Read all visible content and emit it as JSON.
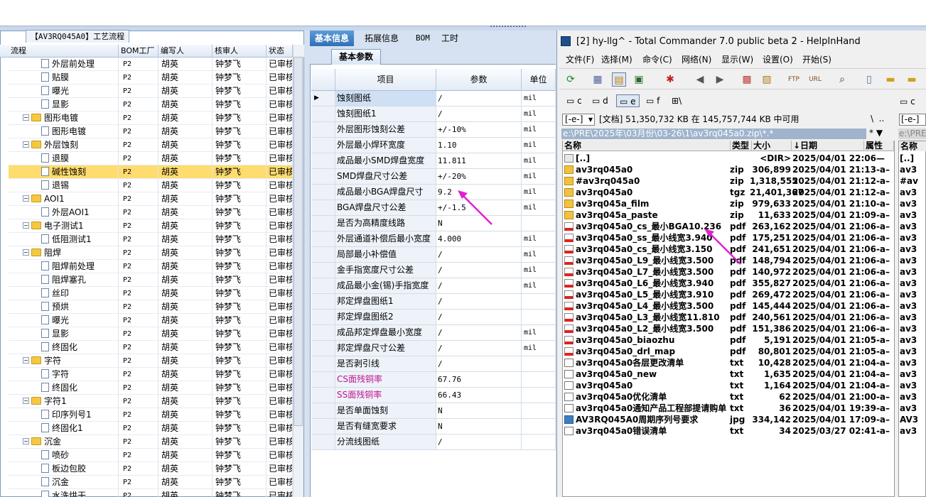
{
  "left_panel": {
    "title": "【AV3RQ045A0】工艺流程",
    "headers": [
      "流程",
      "BOM工厂",
      "编写人",
      "核审人",
      "状态"
    ],
    "rows": [
      {
        "indent": 3,
        "icon": "doc",
        "label": "外层前处理",
        "factory": "P2",
        "writer": "胡英",
        "reviewer": "钟梦飞",
        "status": "已审核"
      },
      {
        "indent": 3,
        "icon": "doc",
        "label": "贴膜",
        "factory": "P2",
        "writer": "胡英",
        "reviewer": "钟梦飞",
        "status": "已审核"
      },
      {
        "indent": 3,
        "icon": "doc",
        "label": "曝光",
        "factory": "P2",
        "writer": "胡英",
        "reviewer": "钟梦飞",
        "status": "已审核"
      },
      {
        "indent": 3,
        "icon": "doc",
        "label": "显影",
        "factory": "P2",
        "writer": "胡英",
        "reviewer": "钟梦飞",
        "status": "已审核"
      },
      {
        "indent": 1,
        "icon": "folder",
        "label": "图形电镀",
        "factory": "P2",
        "writer": "胡英",
        "reviewer": "钟梦飞",
        "status": "已审核"
      },
      {
        "indent": 3,
        "icon": "doc",
        "label": "图形电镀",
        "factory": "P2",
        "writer": "胡英",
        "reviewer": "钟梦飞",
        "status": "已审核"
      },
      {
        "indent": 1,
        "icon": "folder",
        "label": "外层蚀刻",
        "factory": "P2",
        "writer": "胡英",
        "reviewer": "钟梦飞",
        "status": "已审核"
      },
      {
        "indent": 3,
        "icon": "doc",
        "label": "退膜",
        "factory": "P2",
        "writer": "胡英",
        "reviewer": "钟梦飞",
        "status": "已审核"
      },
      {
        "indent": 3,
        "icon": "doc",
        "label": "碱性蚀刻",
        "factory": "P2",
        "writer": "胡英",
        "reviewer": "钟梦飞",
        "status": "已审核",
        "selected": true
      },
      {
        "indent": 3,
        "icon": "doc",
        "label": "退锡",
        "factory": "P2",
        "writer": "胡英",
        "reviewer": "钟梦飞",
        "status": "已审核"
      },
      {
        "indent": 1,
        "icon": "folder",
        "label": "AOI1",
        "factory": "P2",
        "writer": "胡英",
        "reviewer": "钟梦飞",
        "status": "已审核"
      },
      {
        "indent": 3,
        "icon": "doc",
        "label": "外层AOI1",
        "factory": "P2",
        "writer": "胡英",
        "reviewer": "钟梦飞",
        "status": "已审核"
      },
      {
        "indent": 1,
        "icon": "folder",
        "label": "电子测试1",
        "factory": "P2",
        "writer": "胡英",
        "reviewer": "钟梦飞",
        "status": "已审核"
      },
      {
        "indent": 3,
        "icon": "doc",
        "label": "低阻测试1",
        "factory": "P2",
        "writer": "胡英",
        "reviewer": "钟梦飞",
        "status": "已审核"
      },
      {
        "indent": 1,
        "icon": "folder",
        "label": "阻焊",
        "factory": "P2",
        "writer": "胡英",
        "reviewer": "钟梦飞",
        "status": "已审核"
      },
      {
        "indent": 3,
        "icon": "doc",
        "label": "阻焊前处理",
        "factory": "P2",
        "writer": "胡英",
        "reviewer": "钟梦飞",
        "status": "已审核"
      },
      {
        "indent": 3,
        "icon": "doc",
        "label": "阻焊塞孔",
        "factory": "P2",
        "writer": "胡英",
        "reviewer": "钟梦飞",
        "status": "已审核"
      },
      {
        "indent": 3,
        "icon": "doc",
        "label": "丝印",
        "factory": "P2",
        "writer": "胡英",
        "reviewer": "钟梦飞",
        "status": "已审核"
      },
      {
        "indent": 3,
        "icon": "doc",
        "label": "预烘",
        "factory": "P2",
        "writer": "胡英",
        "reviewer": "钟梦飞",
        "status": "已审核"
      },
      {
        "indent": 3,
        "icon": "doc",
        "label": "曝光",
        "factory": "P2",
        "writer": "胡英",
        "reviewer": "钟梦飞",
        "status": "已审核"
      },
      {
        "indent": 3,
        "icon": "doc",
        "label": "显影",
        "factory": "P2",
        "writer": "胡英",
        "reviewer": "钟梦飞",
        "status": "已审核"
      },
      {
        "indent": 3,
        "icon": "doc",
        "label": "终固化",
        "factory": "P2",
        "writer": "胡英",
        "reviewer": "钟梦飞",
        "status": "已审核"
      },
      {
        "indent": 1,
        "icon": "folder",
        "label": "字符",
        "factory": "P2",
        "writer": "胡英",
        "reviewer": "钟梦飞",
        "status": "已审核"
      },
      {
        "indent": 3,
        "icon": "doc",
        "label": "字符",
        "factory": "P2",
        "writer": "胡英",
        "reviewer": "钟梦飞",
        "status": "已审核"
      },
      {
        "indent": 3,
        "icon": "doc",
        "label": "终固化",
        "factory": "P2",
        "writer": "胡英",
        "reviewer": "钟梦飞",
        "status": "已审核"
      },
      {
        "indent": 1,
        "icon": "folder",
        "label": "字符1",
        "factory": "P2",
        "writer": "胡英",
        "reviewer": "钟梦飞",
        "status": "已审核"
      },
      {
        "indent": 3,
        "icon": "doc",
        "label": "印序列号1",
        "factory": "P2",
        "writer": "胡英",
        "reviewer": "钟梦飞",
        "status": "已审核"
      },
      {
        "indent": 3,
        "icon": "doc",
        "label": "终固化1",
        "factory": "P2",
        "writer": "胡英",
        "reviewer": "钟梦飞",
        "status": "已审核"
      },
      {
        "indent": 1,
        "icon": "folder",
        "label": "沉金",
        "factory": "P2",
        "writer": "胡英",
        "reviewer": "钟梦飞",
        "status": "已审核"
      },
      {
        "indent": 3,
        "icon": "doc",
        "label": "喷砂",
        "factory": "P2",
        "writer": "胡英",
        "reviewer": "钟梦飞",
        "status": "已审核"
      },
      {
        "indent": 3,
        "icon": "doc",
        "label": "板边包胶",
        "factory": "P2",
        "writer": "胡英",
        "reviewer": "钟梦飞",
        "status": "已审核"
      },
      {
        "indent": 3,
        "icon": "doc",
        "label": "沉金",
        "factory": "P2",
        "writer": "胡英",
        "reviewer": "钟梦飞",
        "status": "已审核"
      },
      {
        "indent": 3,
        "icon": "doc",
        "label": "水洗烘干",
        "factory": "P2",
        "writer": "胡英",
        "reviewer": "钟梦飞",
        "status": "已审核"
      }
    ]
  },
  "mid_panel": {
    "tabs": [
      "基本信息",
      "拓展信息",
      "BOM",
      "工时"
    ],
    "subtab": "基本参数",
    "headers": [
      "项目",
      "参数",
      "单位"
    ],
    "rows": [
      {
        "item": "蚀刻图纸",
        "value": "/",
        "unit": "mil"
      },
      {
        "item": "蚀刻图纸1",
        "value": "/",
        "unit": "mil"
      },
      {
        "item": "外层图形蚀刻公差",
        "value": "+/-10%",
        "unit": "mil"
      },
      {
        "item": "外层最小焊环宽度",
        "value": "1.10",
        "unit": "mil"
      },
      {
        "item": "成品最小SMD焊盘宽度",
        "value": "11.811",
        "unit": "mil"
      },
      {
        "item": "SMD焊盘尺寸公差",
        "value": "+/-20%",
        "unit": "mil"
      },
      {
        "item": "成品最小BGA焊盘尺寸",
        "value": "9.2",
        "unit": "mil"
      },
      {
        "item": "BGA焊盘尺寸公差",
        "value": "+/-1.5",
        "unit": "mil"
      },
      {
        "item": "是否为高精度线路",
        "value": "N",
        "unit": ""
      },
      {
        "item": "外层通道补偿后最小宽度",
        "value": "4.000",
        "unit": "mil"
      },
      {
        "item": "局部最小补偿值",
        "value": "/",
        "unit": "mil"
      },
      {
        "item": "金手指宽度尺寸公差",
        "value": "/",
        "unit": "mil"
      },
      {
        "item": "成品最小金(锡)手指宽度",
        "value": "/",
        "unit": "mil"
      },
      {
        "item": "邦定焊盘图纸1",
        "value": "/",
        "unit": ""
      },
      {
        "item": "邦定焊盘图纸2",
        "value": "/",
        "unit": ""
      },
      {
        "item": "成品邦定焊盘最小宽度",
        "value": "/",
        "unit": "mil"
      },
      {
        "item": "邦定焊盘尺寸公差",
        "value": "/",
        "unit": "mil"
      },
      {
        "item": "是否剥引线",
        "value": "/",
        "unit": ""
      },
      {
        "item": "CS面残铜率",
        "value": "67.76",
        "unit": "",
        "pink": true
      },
      {
        "item": "SS面残铜率",
        "value": "66.43",
        "unit": "",
        "pink": true
      },
      {
        "item": "是否单面蚀刻",
        "value": "N",
        "unit": ""
      },
      {
        "item": "是否有缝宽要求",
        "value": "N",
        "unit": ""
      },
      {
        "item": "分流线图纸",
        "value": "/",
        "unit": ""
      }
    ]
  },
  "tc": {
    "title": "[2] hy-llg^ - Total Commander 7.0 public beta 2 - HelpInHand",
    "menu": [
      "文件(F)",
      "选择(M)",
      "命令(C)",
      "网络(N)",
      "显示(W)",
      "设置(O)",
      "开始(S)"
    ],
    "drives": [
      "c",
      "d",
      "e",
      "f",
      "\\"
    ],
    "drive_combo": "[-e-]",
    "free_space": "[文档]  51,350,732 KB 在 145,757,744 KB 中可用",
    "path": "e:\\PRE\\2025年\\03月份\\03-26\\1\\av3rq045a0.zip\\*.*",
    "columns": [
      "名称",
      "类型",
      "大小",
      "↓日期",
      "属性"
    ],
    "files": [
      {
        "icon": "up",
        "name": "[..]",
        "ext": "",
        "size": "<DIR>",
        "date": "2025/04/01 22:06—"
      },
      {
        "icon": "zip",
        "name": "av3rq045a0",
        "ext": "zip",
        "size": "306,899",
        "date": "2025/04/01 21:13-a–"
      },
      {
        "icon": "zip",
        "name": "#av3rq045a0",
        "ext": "zip",
        "size": "1,318,555",
        "date": "2025/04/01 21:12-a–"
      },
      {
        "icon": "zip",
        "name": "av3rq045a0",
        "ext": "tgz",
        "size": "21,401,367",
        "date": "2025/04/01 21:12-a–"
      },
      {
        "icon": "zip",
        "name": "av3rq045a_film",
        "ext": "zip",
        "size": "979,633",
        "date": "2025/04/01 21:10-a–"
      },
      {
        "icon": "zip",
        "name": "av3rq045a_paste",
        "ext": "zip",
        "size": "11,633",
        "date": "2025/04/01 21:09-a–"
      },
      {
        "icon": "pdf",
        "name": "av3rq045a0_cs_最小BGA10.236",
        "ext": "pdf",
        "size": "263,162",
        "date": "2025/04/01 21:06-a–"
      },
      {
        "icon": "pdf",
        "name": "av3rq045a0_ss_最小线宽3.940",
        "ext": "pdf",
        "size": "175,251",
        "date": "2025/04/01 21:06-a–"
      },
      {
        "icon": "pdf",
        "name": "av3rq045a0_cs_最小线宽3.150",
        "ext": "pdf",
        "size": "241,651",
        "date": "2025/04/01 21:06-a–"
      },
      {
        "icon": "pdf",
        "name": "av3rq045a0_L9_最小线宽3.500",
        "ext": "pdf",
        "size": "148,794",
        "date": "2025/04/01 21:06-a–"
      },
      {
        "icon": "pdf",
        "name": "av3rq045a0_L7_最小线宽3.500",
        "ext": "pdf",
        "size": "140,972",
        "date": "2025/04/01 21:06-a–"
      },
      {
        "icon": "pdf",
        "name": "av3rq045a0_L6_最小线宽3.940",
        "ext": "pdf",
        "size": "355,827",
        "date": "2025/04/01 21:06-a–"
      },
      {
        "icon": "pdf",
        "name": "av3rq045a0_L5_最小线宽3.910",
        "ext": "pdf",
        "size": "269,472",
        "date": "2025/04/01 21:06-a–"
      },
      {
        "icon": "pdf",
        "name": "av3rq045a0_L4_最小线宽3.500",
        "ext": "pdf",
        "size": "145,444",
        "date": "2025/04/01 21:06-a–"
      },
      {
        "icon": "pdf",
        "name": "av3rq045a0_L3_最小线宽11.810",
        "ext": "pdf",
        "size": "240,561",
        "date": "2025/04/01 21:06-a–"
      },
      {
        "icon": "pdf",
        "name": "av3rq045a0_L2_最小线宽3.500",
        "ext": "pdf",
        "size": "151,386",
        "date": "2025/04/01 21:06-a–"
      },
      {
        "icon": "pdf",
        "name": "av3rq045a0_biaozhu",
        "ext": "pdf",
        "size": "5,191",
        "date": "2025/04/01 21:05-a–"
      },
      {
        "icon": "pdf",
        "name": "av3rq045a0_drl_map",
        "ext": "pdf",
        "size": "80,801",
        "date": "2025/04/01 21:05-a–"
      },
      {
        "icon": "txt",
        "name": "av3rq045a0各层更改清单",
        "ext": "txt",
        "size": "10,428",
        "date": "2025/04/01 21:04-a–"
      },
      {
        "icon": "txt",
        "name": "av3rq045a0_new",
        "ext": "txt",
        "size": "1,635",
        "date": "2025/04/01 21:04-a–"
      },
      {
        "icon": "txt",
        "name": "av3rq045a0",
        "ext": "txt",
        "size": "1,164",
        "date": "2025/04/01 21:04-a–"
      },
      {
        "icon": "txt",
        "name": "av3rq045a0优化清单",
        "ext": "txt",
        "size": "62",
        "date": "2025/04/01 21:00-a–"
      },
      {
        "icon": "txt",
        "name": "av3rq045a0通知产品工程部提请购单",
        "ext": "txt",
        "size": "36",
        "date": "2025/04/01 19:39-a–"
      },
      {
        "icon": "jpg",
        "name": "AV3RQ045A0周期序列号要求",
        "ext": "jpg",
        "size": "334,142",
        "date": "2025/04/01 17:09-a–"
      },
      {
        "icon": "txt",
        "name": "av3rq045a0错误清单",
        "ext": "txt",
        "size": "34",
        "date": "2025/03/27 02:41-a–"
      }
    ],
    "right_drive": "c",
    "right_combo": "[-e-]",
    "right_path": "e:\\PRE",
    "right_col": "名称",
    "right_files": [
      "[..]",
      "av3",
      "#av",
      "av3",
      "av3",
      "av3",
      "av3",
      "av3",
      "av3",
      "av3",
      "av3",
      "av3",
      "av3",
      "av3",
      "av3",
      "av3",
      "av3",
      "av3",
      "av3",
      "av3",
      "av3",
      "av3",
      "av3",
      "AV3",
      "av3"
    ]
  },
  "colors": {
    "selected_row": "#ffdc6e",
    "accent_tab": "#2f6fb5",
    "annotation_arrow": "#e020d0",
    "pink_text": "#c0148c"
  }
}
